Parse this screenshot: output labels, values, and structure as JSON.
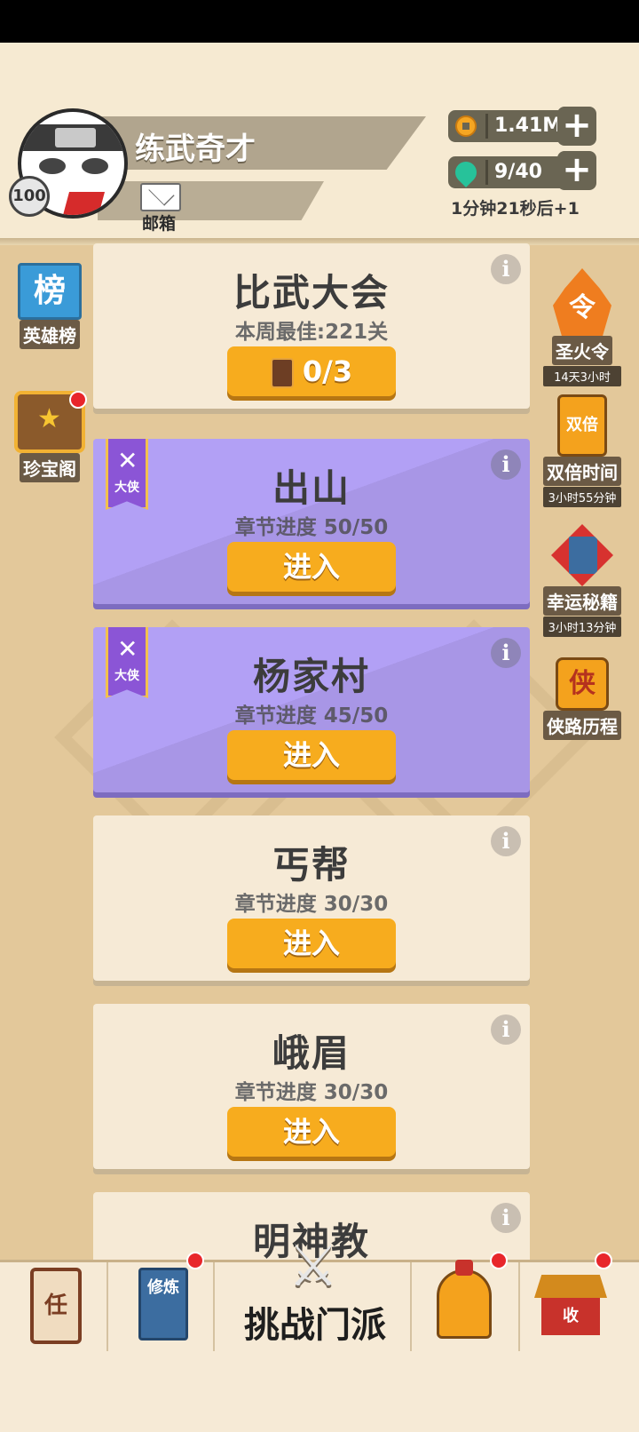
{
  "player": {
    "name": "练武奇才",
    "level": "100",
    "mail_label": "邮箱"
  },
  "resources": {
    "coins": "1.41M",
    "stamina": "9/40",
    "stamina_timer": "1分钟21秒后+1",
    "plus_symbol": "+"
  },
  "left_sidebar": [
    {
      "label": "英雄榜",
      "icon": "rank-banner-icon",
      "icon_text": "榜"
    },
    {
      "label": "珍宝阁",
      "icon": "treasure-chest-icon",
      "has_notification": true
    }
  ],
  "right_sidebar": [
    {
      "label": "圣火令",
      "sub": "14天3小时",
      "icon": "flame-token-icon",
      "icon_text": "令"
    },
    {
      "label": "双倍时间",
      "sub": "3小时55分钟",
      "icon": "double-scroll-icon",
      "icon_text": "双倍"
    },
    {
      "label": "幸运秘籍",
      "sub": "3小时13分钟",
      "icon": "lucky-book-icon"
    },
    {
      "label": "侠路历程",
      "icon": "hero-road-icon",
      "icon_text": "侠"
    }
  ],
  "cards": [
    {
      "title": "比武大会",
      "subtitle": "本周最佳:221关",
      "button": "0/3",
      "style": "plain",
      "button_icon": "ticket-icon"
    },
    {
      "title": "出山",
      "subtitle": "章节进度 50/50",
      "button": "进入",
      "style": "purple",
      "badge": "大侠"
    },
    {
      "title": "杨家村",
      "subtitle": "章节进度 45/50",
      "button": "进入",
      "style": "purple",
      "badge": "大侠"
    },
    {
      "title": "丐帮",
      "subtitle": "章节进度 30/30",
      "button": "进入",
      "style": "plain"
    },
    {
      "title": "峨眉",
      "subtitle": "章节进度 30/30",
      "button": "进入",
      "style": "plain"
    },
    {
      "title": "明神教",
      "style": "plain"
    }
  ],
  "info_symbol": "i",
  "bottom_nav": [
    {
      "icon": "quest-scroll-icon",
      "icon_text": "任"
    },
    {
      "icon": "cultivation-book-icon",
      "icon_text": "修炼",
      "has_notification": true
    },
    {
      "label": "挑战门派",
      "icon": "crossed-swords-icon",
      "active": true
    },
    {
      "icon": "helmet-icon",
      "has_notification": true
    },
    {
      "icon": "collect-house-icon",
      "icon_text": "收",
      "has_notification": true
    }
  ],
  "colors": {
    "accent_orange": "#f7ac1e",
    "purple_card": "#a896e6",
    "notification_red": "#e8262b"
  }
}
